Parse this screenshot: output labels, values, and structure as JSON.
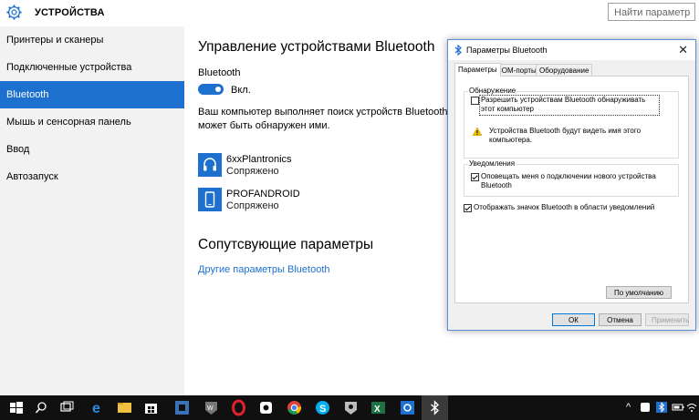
{
  "window": {
    "title": "УСТРОЙСТВА",
    "search_placeholder": "Найти параметр"
  },
  "sidebar": {
    "items": [
      {
        "label": "Принтеры и сканеры",
        "active": false
      },
      {
        "label": "Подключенные устройства",
        "active": false
      },
      {
        "label": "Bluetooth",
        "active": true
      },
      {
        "label": "Мышь и сенсорная панель",
        "active": false
      },
      {
        "label": "Ввод",
        "active": false
      },
      {
        "label": "Автозапуск",
        "active": false
      }
    ]
  },
  "main": {
    "heading": "Управление устройствами Bluetooth",
    "bluetooth_label": "Bluetooth",
    "toggle_state": "Вкл.",
    "description": "Ваш компьютер выполняет поиск устройств Bluetooth и может быть обнаружен ими.",
    "devices": [
      {
        "name": "6xxPlantronics",
        "status": "Сопряжено",
        "icon": "headset-icon"
      },
      {
        "name": "PROFANDROID",
        "status": "Сопряжено",
        "icon": "phone-icon"
      }
    ],
    "related_heading": "Сопутсвующие параметры",
    "related_link": "Другие параметры Bluetooth"
  },
  "dialog": {
    "title": "Параметры Bluetooth",
    "close_glyph": "✕",
    "tabs": [
      "Параметры",
      "COM-порты",
      "Оборудование"
    ],
    "discovery": {
      "label": "Обнаружение",
      "checkbox_text": "Разрешить устройствам Bluetooth обнаруживать этот компьютер",
      "checked": false,
      "warning": "Устройства Bluetooth будут видеть имя этого компьютера."
    },
    "notifications": {
      "label": "Уведомления",
      "checkbox_text": "Оповещать меня о подключении нового устройства Bluetooth",
      "checked": true
    },
    "tray_checkbox": {
      "text": "Отображать значок Bluetooth в области уведомлений",
      "checked": true
    },
    "default_button": "По умолчанию",
    "ok_button": "ОК",
    "cancel_button": "Отмена",
    "apply_button": "Применить"
  },
  "taskbar": {
    "apps": [
      "start-icon",
      "search-icon",
      "task-view-icon",
      "edge-icon",
      "file-explorer-icon",
      "store-icon",
      "unity-icon",
      "world-of-tanks-icon",
      "opera-icon",
      "app-icon",
      "chrome-icon",
      "skype-icon",
      "app2-icon",
      "excel-icon",
      "settings-icon",
      "bluetooth-icon"
    ],
    "tray_chevron": "^"
  },
  "colors": {
    "accent": "#1e70cf",
    "sidebar_bg": "#f2f2f2",
    "taskbar_bg": "#101010"
  }
}
